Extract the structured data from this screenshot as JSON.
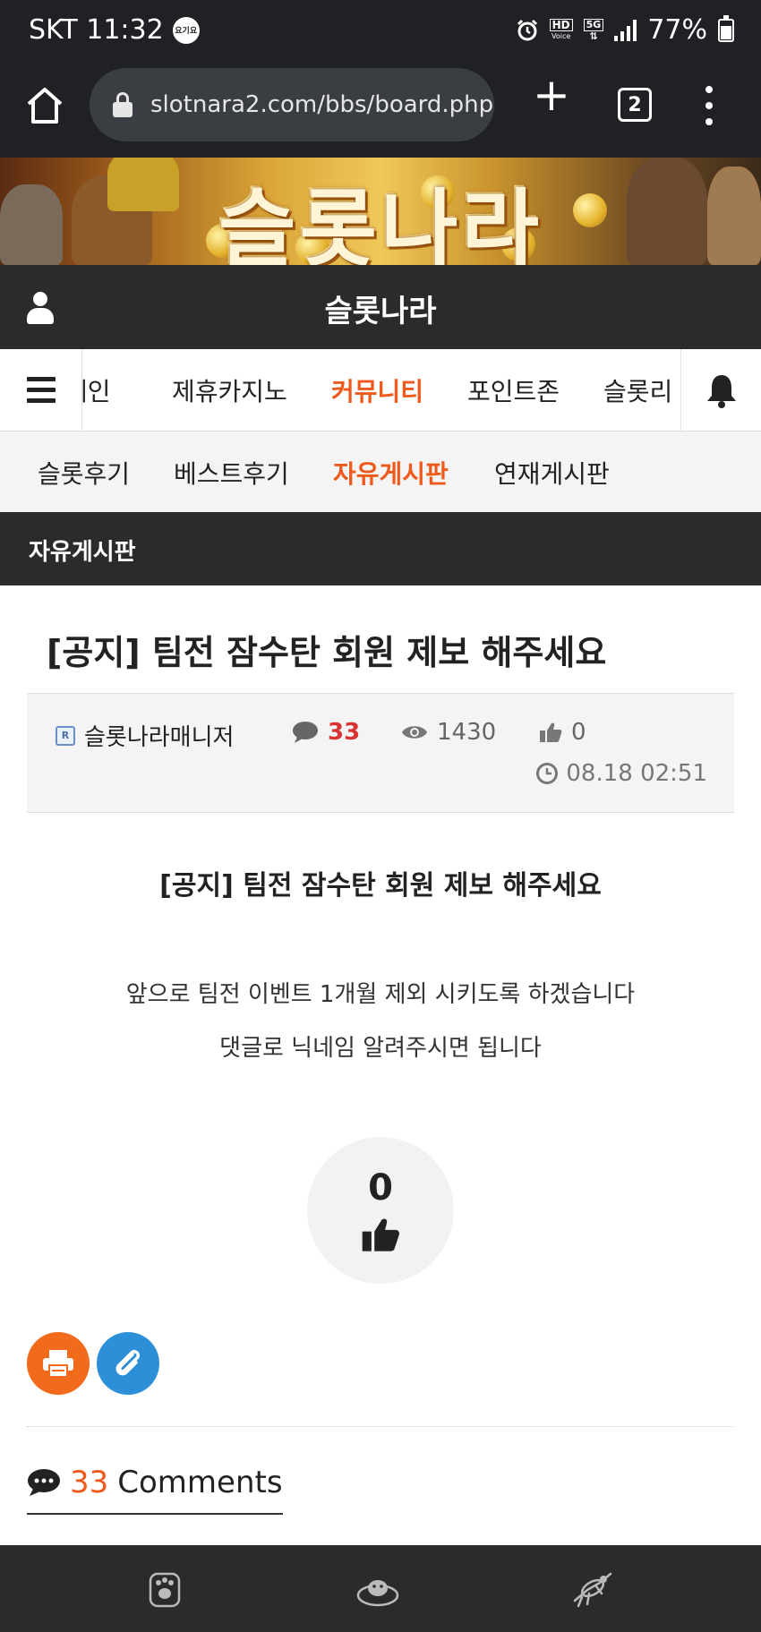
{
  "status_bar": {
    "carrier_time": "SKT 11:32",
    "indicator": "요기요",
    "hd_label": "HD",
    "voice_label": "Voice",
    "network": "5G",
    "battery": "77%"
  },
  "browser": {
    "url": "slotnara2.com/bbs/board.php?",
    "tab_count": "2"
  },
  "banner": {
    "text": "슬롯나라"
  },
  "header": {
    "site_title": "슬롯나라"
  },
  "main_nav": {
    "items": [
      {
        "label": "메인",
        "active": false
      },
      {
        "label": "제휴카지노",
        "active": false
      },
      {
        "label": "커뮤니티",
        "active": true
      },
      {
        "label": "포인트존",
        "active": false
      },
      {
        "label": "슬롯리",
        "active": false
      }
    ]
  },
  "sub_nav": {
    "items": [
      {
        "label": "슬롯후기",
        "active": false
      },
      {
        "label": "베스트후기",
        "active": false
      },
      {
        "label": "자유게시판",
        "active": true
      },
      {
        "label": "연재게시판",
        "active": false
      }
    ]
  },
  "page_header": {
    "title": "자유게시판"
  },
  "post": {
    "title": "[공지] 팀전 잠수탄 회원 제보 해주세요",
    "author_badge": "R",
    "author": "슬롯나라매니저",
    "comments": "33",
    "views": "1430",
    "likes": "0",
    "date": "08.18 02:51",
    "content_title": "[공지] 팀전 잠수탄 회원 제보 해주세요",
    "content_lines": [
      "앞으로 팀전 이벤트 1개월 제외 시키도록 하겠습니다",
      "댓글로 닉네임 알려주시면 됩니다"
    ],
    "like_count": "0"
  },
  "comments": {
    "count": "33",
    "label": "Comments"
  },
  "colors": {
    "accent": "#ee5a1b",
    "dark_bar": "#2a2b2d",
    "print_button": "#f26a1b",
    "clip_button": "#2d8fd8",
    "comment_count": "#d83232"
  }
}
